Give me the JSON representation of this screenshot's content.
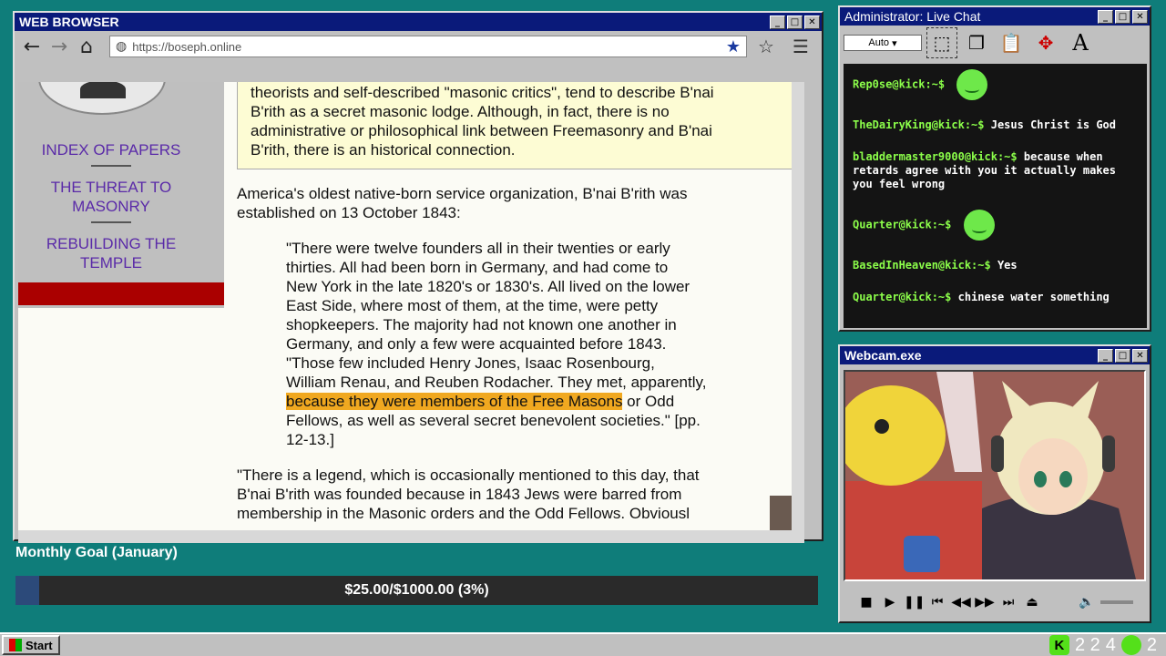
{
  "browser": {
    "title": "WEB BROWSER",
    "url": "https://boseph.online",
    "sidebar": {
      "links": [
        "INDEX OF PAPERS",
        "THE THREAT TO MASONRY",
        "REBUILDING THE TEMPLE"
      ]
    },
    "quotebox": {
      "line1": "theorists and self-described \"masonic critics\", tend to describe B'nai",
      "line2": "B'rith as a secret masonic lodge. Although, in fact, there is no",
      "line3": "administrative or philosophical link between Freemasonry and B'nai",
      "line4": "B'rith, there is an historical connection."
    },
    "intro": {
      "line1": "America's oldest native-born service organization, B'nai B'rith was",
      "line2": "established on 13 October 1843:"
    },
    "quote": {
      "l1": "\"There were twelve founders all in their twenties or early",
      "l2": "thirties. All had been born in Germany, and had come to",
      "l3": "New York in the late 1820's or 1830's. All lived on the lower",
      "l4": "East Side, where most of them, at the time, were petty",
      "l5": "shopkeepers. The majority had not known one another in",
      "l6": "Germany, and only a few were acquainted before 1843.",
      "l7": "\"Those few included Henry Jones, Isaac Rosenbourg,",
      "l8": "William Renau, and Reuben Rodacher. They met, apparently,",
      "l9_highlight": "because they were members of the Free Masons",
      "l9_rest": " or Odd",
      "l10": "Fellows, as well as several secret benevolent societies.\" [pp.",
      "l11": "12-13.]"
    },
    "legend": {
      "l1": "\"There is a legend, which is occasionally mentioned to this day, that",
      "l2": "B'nai B'rith was founded because in 1843 Jews were barred from",
      "l3": "membership in the Masonic orders and the Odd Fellows. Obviousl"
    }
  },
  "chat": {
    "title": "Administrator: Live Chat",
    "auto_label": "Auto",
    "messages": [
      {
        "user": "Rep0se@kick:~$",
        "text": ""
      },
      {
        "user": "TheDairyKing@kick:~$",
        "text": "Jesus Christ is God"
      },
      {
        "user": "bladdermaster9000@kick:~$",
        "text": "because when retards agree with you it actually makes you feel wrong"
      },
      {
        "user": "Quarter@kick:~$",
        "text": ""
      },
      {
        "user": "BasedInHeaven@kick:~$",
        "text": "Yes"
      },
      {
        "user": "Quarter@kick:~$",
        "text": "chinese water something"
      }
    ]
  },
  "webcam": {
    "title": "Webcam.exe"
  },
  "goal": {
    "title": "Monthly Goal (January)",
    "amount_text": "$25.00/$1000.00 (3%)",
    "progress_fraction": 0.03
  },
  "taskbar": {
    "start_label": "Start",
    "tray_left": "2 2",
    "tray_mid": "4",
    "tray_right": "2"
  }
}
